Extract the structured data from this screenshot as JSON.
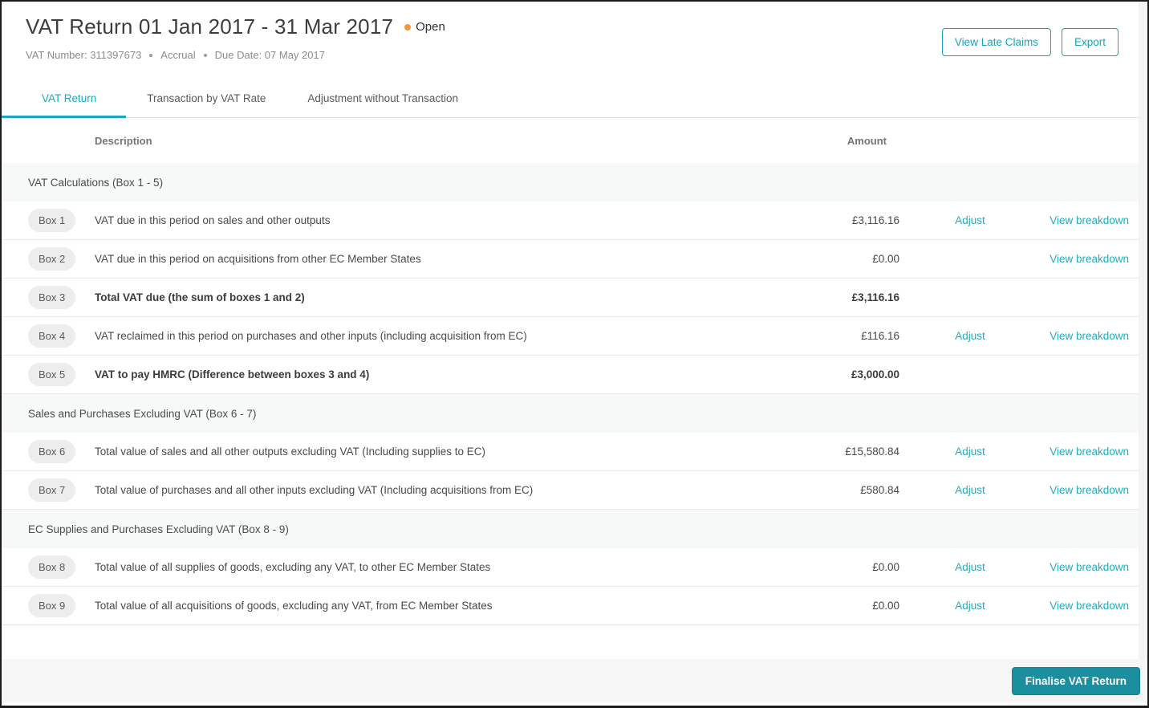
{
  "header": {
    "title": "VAT Return 01 Jan 2017 - 31 Mar 2017",
    "status": "Open",
    "vat_number": "VAT Number: 311397673",
    "basis": "Accrual",
    "due_date": "Due Date: 07 May 2017",
    "view_late_claims_label": "View Late Claims",
    "export_label": "Export"
  },
  "tabs": [
    {
      "label": "VAT Return",
      "active": true
    },
    {
      "label": "Transaction by VAT Rate",
      "active": false
    },
    {
      "label": "Adjustment without Transaction",
      "active": false
    }
  ],
  "table": {
    "columns": {
      "description": "Description",
      "amount": "Amount"
    },
    "adjust_label": "Adjust",
    "view_breakdown_label": "View breakdown",
    "sections": [
      {
        "title": "VAT Calculations (Box 1 - 5)",
        "rows": [
          {
            "box": "Box 1",
            "description": "VAT due in this period on sales and other outputs",
            "amount": "£3,116.16",
            "bold": false,
            "adjust": true,
            "breakdown": true
          },
          {
            "box": "Box 2",
            "description": "VAT due in this period on acquisitions from other EC Member States",
            "amount": "£0.00",
            "bold": false,
            "adjust": false,
            "breakdown": true
          },
          {
            "box": "Box 3",
            "description": "Total VAT due (the sum of boxes 1 and 2)",
            "amount": "£3,116.16",
            "bold": true,
            "adjust": false,
            "breakdown": false
          },
          {
            "box": "Box 4",
            "description": "VAT reclaimed in this period on purchases and other inputs (including acquisition from EC)",
            "amount": "£116.16",
            "bold": false,
            "adjust": true,
            "breakdown": true
          },
          {
            "box": "Box 5",
            "description": "VAT to pay HMRC (Difference between boxes 3 and 4)",
            "amount": "£3,000.00",
            "bold": true,
            "adjust": false,
            "breakdown": false
          }
        ]
      },
      {
        "title": "Sales and Purchases Excluding VAT (Box 6 - 7)",
        "rows": [
          {
            "box": "Box 6",
            "description": "Total value of sales and all other outputs excluding VAT (Including supplies to EC)",
            "amount": "£15,580.84",
            "bold": false,
            "adjust": true,
            "breakdown": true
          },
          {
            "box": "Box 7",
            "description": "Total value of purchases and all other inputs excluding VAT (Including acquisitions from EC)",
            "amount": "£580.84",
            "bold": false,
            "adjust": true,
            "breakdown": true
          }
        ]
      },
      {
        "title": "EC Supplies and Purchases Excluding VAT (Box 8 - 9)",
        "rows": [
          {
            "box": "Box 8",
            "description": "Total value of all supplies of goods, excluding any VAT, to other EC Member States",
            "amount": "£0.00",
            "bold": false,
            "adjust": true,
            "breakdown": true
          },
          {
            "box": "Box 9",
            "description": "Total value of all acquisitions of goods, excluding any VAT, from EC Member States",
            "amount": "£0.00",
            "bold": false,
            "adjust": true,
            "breakdown": true
          }
        ]
      }
    ]
  },
  "footer": {
    "finalise_label": "Finalise VAT Return"
  },
  "colors": {
    "accent_teal": "#1ba8be",
    "link_teal": "#1fadc4",
    "button_teal": "#1b8fa0",
    "status_orange": "#f5953b",
    "section_bg": "#f7f8f8"
  }
}
